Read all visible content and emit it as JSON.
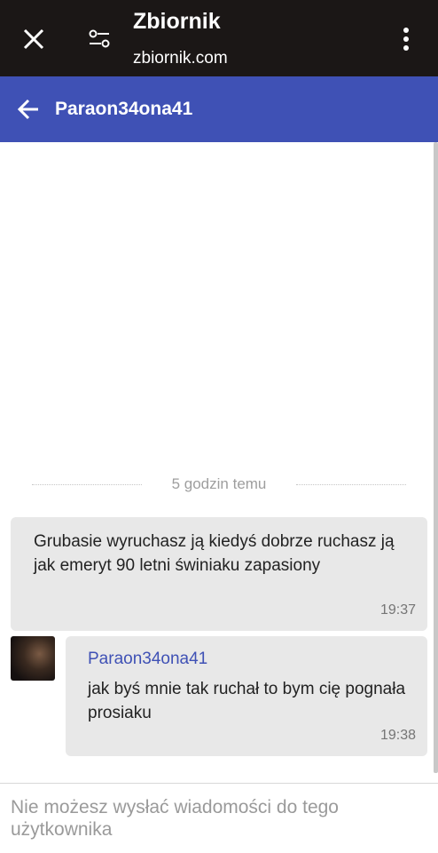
{
  "browser": {
    "title": "Zbiornik",
    "url": "zbiornik.com",
    "icons": {
      "close": "close-icon",
      "tune": "tune-icon",
      "menu": "more-vert-icon"
    }
  },
  "header": {
    "back_icon": "arrow-back-icon",
    "title": "Paraon34ona41",
    "color": "#3f51b5"
  },
  "chat": {
    "divider_label": "5 godzin temu",
    "messages": [
      {
        "text": "Grubasie wyruchasz ją kiedyś dobrze ruchasz ją jak emeryt 90 letni świniaku zapasiony",
        "time": "19:37"
      },
      {
        "sender": "Paraon34ona41",
        "text": "jak byś mnie tak ruchał to bym cię pognała prosiaku",
        "time": "19:38"
      }
    ]
  },
  "footer": {
    "notice": "Nie możesz wysłać wiadomości do tego użytkownika"
  }
}
